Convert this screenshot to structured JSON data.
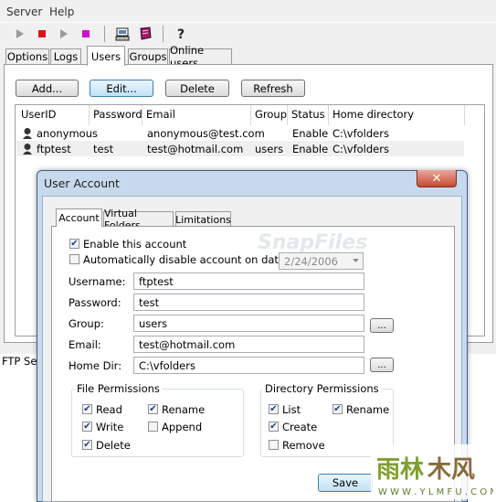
{
  "menu": [
    "Server",
    "Help"
  ],
  "main_tabs": [
    "Options",
    "Logs",
    "Users",
    "Groups",
    "Online users"
  ],
  "buttons": {
    "add": "Add...",
    "edit": "Edit...",
    "delete": "Delete",
    "refresh": "Refresh"
  },
  "list": {
    "headers": [
      "UserID",
      "Password",
      "Email",
      "Group",
      "Status",
      "Home directory"
    ],
    "rows": [
      {
        "userid": "anonymous",
        "password": "",
        "email": "anonymous@test.com",
        "group": "",
        "status": "Enable",
        "home": "C:\\vfolders"
      },
      {
        "userid": "ftptest",
        "password": "test",
        "email": "test@hotmail.com",
        "group": "users",
        "status": "Enable",
        "home": "C:\\vfolders"
      }
    ]
  },
  "status_bar": "FTP Ser",
  "dialog": {
    "title": "User Account",
    "tabs": [
      "Account",
      "Virtual Folders",
      "Limitations"
    ],
    "enable_label": "Enable this account",
    "enable_checked": true,
    "auto_disable_label": "Automatically disable account on date",
    "auto_disable_checked": false,
    "date_value": "2/24/2006",
    "fields": {
      "username_label": "Username:",
      "username": "ftptest",
      "password_label": "Password:",
      "password": "test",
      "group_label": "Group:",
      "group": "users",
      "email_label": "Email:",
      "email": "test@hotmail.com",
      "homedir_label": "Home Dir:",
      "homedir": "C:\\vfolders"
    },
    "browse_label": "...",
    "file_permissions": {
      "title": "File Permissions",
      "items": [
        {
          "label": "Read",
          "checked": true
        },
        {
          "label": "Rename",
          "checked": true
        },
        {
          "label": "Write",
          "checked": true
        },
        {
          "label": "Append",
          "checked": false
        },
        {
          "label": "Delete",
          "checked": true
        }
      ]
    },
    "dir_permissions": {
      "title": "Directory Permissions",
      "items": [
        {
          "label": "List",
          "checked": true
        },
        {
          "label": "Rename",
          "checked": true
        },
        {
          "label": "Create",
          "checked": true
        },
        {
          "label": "Remove",
          "checked": false
        }
      ]
    },
    "save_label": "Save",
    "close_glyph": "✕"
  },
  "watermark_text": "SnapFiles",
  "logo": {
    "text": "雨林木风",
    "url_text": "W W W . Y L M F U . C O M"
  },
  "colors": {
    "stop": "#e0101a",
    "pause": "#d010d0",
    "dialog_frame": "#c7daed",
    "accent": "#3c7fb1"
  }
}
